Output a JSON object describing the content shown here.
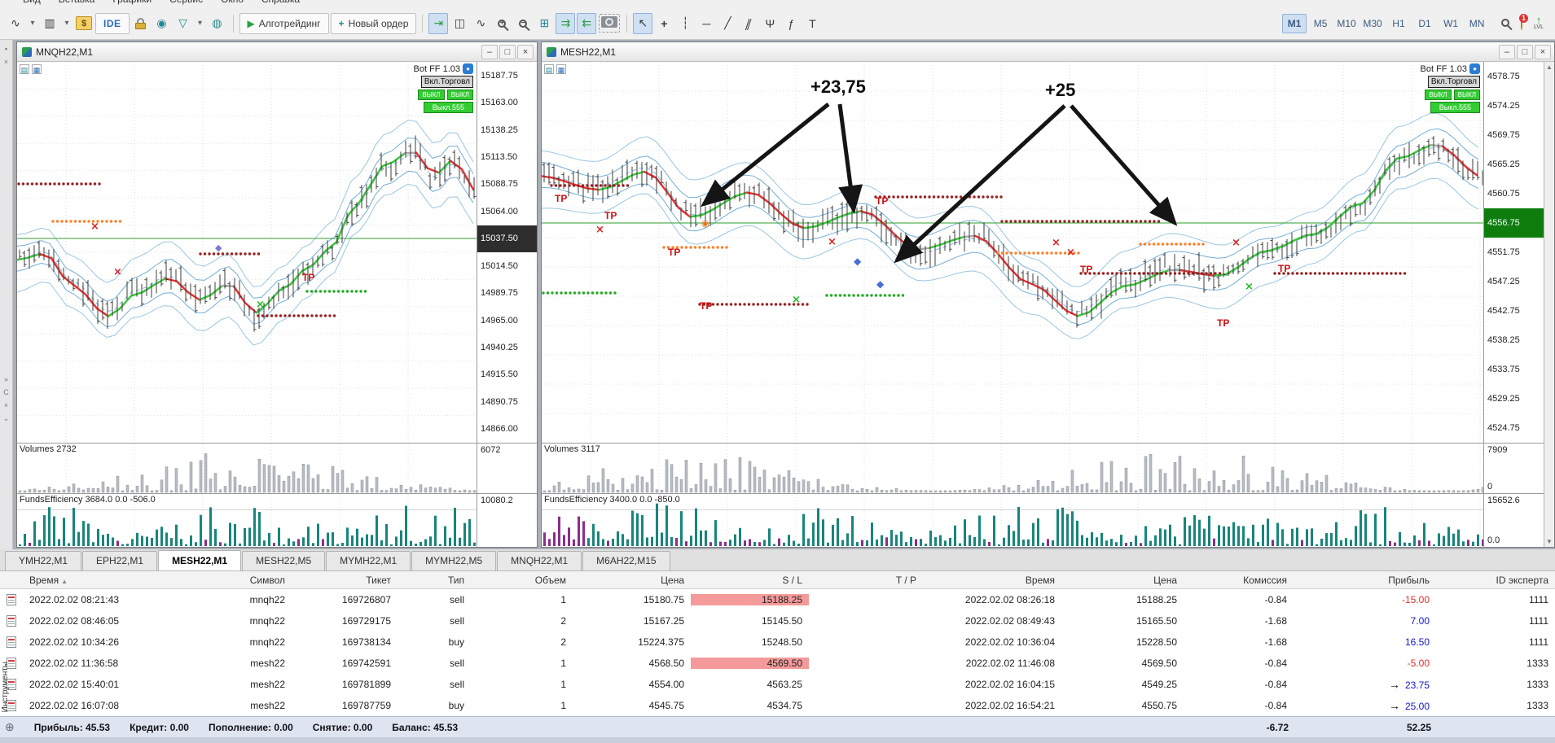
{
  "menu": {
    "items": [
      "Вид",
      "Вставка",
      "Графики",
      "Сервис",
      "Окно",
      "Справка"
    ]
  },
  "toolbar": {
    "ide": "IDE",
    "algotrading": "Алготрейдинг",
    "new_order": "Новый ордер",
    "timeframes": [
      "M1",
      "M5",
      "M10",
      "M30",
      "H1",
      "D1",
      "W1",
      "MN"
    ],
    "active_timeframe": "M1",
    "badge_count": "1",
    "lvl": "LVL"
  },
  "icons": {
    "caret_down": "▾",
    "line_style": "∿",
    "bar_style": "▥",
    "dollar": "$",
    "signal": "◉",
    "funnel": "▽",
    "copy": "◍",
    "play": "▶",
    "plus": "+",
    "autoscroll": "⇥",
    "candles": "◫",
    "line_chart": "∿",
    "grid": "⊞",
    "dock_left": "⇉",
    "dock_right": "⇇",
    "cursor": "↖",
    "crosshair": "+",
    "vline": "┆",
    "hline": "─",
    "trendline": "╱",
    "channel": "∥",
    "pitchfork": "Ψ",
    "fibo": "ƒ",
    "text_tool": "T",
    "zoom_in": "+",
    "zoom_out": "−",
    "sort_asc": "▲",
    "up_arrow": "↑",
    "minimize": "–",
    "maximize": "□",
    "close": "×",
    "row_arrow": "→",
    "plus_circle": "⊕",
    "scroll_up": "▲",
    "scroll_down": "▼",
    "strip_glyphs": [
      "▪",
      "×",
      "»",
      "C",
      "×",
      "⌄"
    ]
  },
  "charts": {
    "left": {
      "title": "MNQH22,M1",
      "bot_label": "Bot FF 1.03",
      "toggle_label": "Вкл.Торговл",
      "btn_a": "ВЫКЛ",
      "btn_b": "ВЫКЛ",
      "btn_c": "Выкл.555",
      "price_labels": [
        "15187.75",
        "15163.00",
        "15138.25",
        "15113.50",
        "15088.75",
        "15064.00",
        "15037.50",
        "15014.50",
        "14989.75",
        "14965.00",
        "14940.25",
        "14915.50",
        "14890.75",
        "14866.00"
      ],
      "current_index": 6,
      "current_price": "15037.50",
      "volumes_label": "Volumes 2732",
      "volumes_axis_top": "6072",
      "funds_label": "FundsEfficiency 3684.0 0.0 -506.0",
      "funds_axis_top": "10080.2",
      "tp_label": "TP"
    },
    "right": {
      "title": "MESH22,M1",
      "bot_label": "Bot FF 1.03",
      "toggle_label": "Вкл.Торговл",
      "btn_a": "ВЫКЛ",
      "btn_b": "ВЫКЛ",
      "btn_c": "Выкл.555",
      "price_labels": [
        "4578.75",
        "4574.25",
        "4569.75",
        "4565.25",
        "4560.75",
        "4556.75",
        "4551.75",
        "4547.25",
        "4542.75",
        "4538.25",
        "4533.75",
        "4529.25",
        "4524.75"
      ],
      "current_index": 5,
      "current_price": "4556.75",
      "volumes_label": "Volumes 3117",
      "volumes_axis_top": "7909",
      "volumes_axis_bottom": "0",
      "funds_label": "FundsEfficiency 3400.0 0.0 -850.0",
      "funds_axis_top": "15652.6",
      "funds_axis_bottom": "0.0",
      "annotation_1": "+23,75",
      "annotation_2": "+25",
      "tp_label": "TP"
    }
  },
  "chart_tabs": {
    "items": [
      "YMH22,M1",
      "EPH22,M1",
      "MESH22,M1",
      "MESH22,M5",
      "MYMH22,M1",
      "MYMH22,M5",
      "MNQH22,M1",
      "M6AH22,M15"
    ],
    "active_index": 2
  },
  "table": {
    "columns": [
      "Время",
      "Символ",
      "Тикет",
      "Тип",
      "Объем",
      "Цена",
      "S / L",
      "T / P",
      "Время",
      "Цена",
      "Комиссия",
      "Прибыль",
      "ID эксперта"
    ],
    "rows": [
      {
        "time_open": "2022.02.02 08:21:43",
        "symbol": "mnqh22",
        "ticket": "169726807",
        "type": "sell",
        "volume": "1",
        "price_open": "15180.75",
        "sl": "15188.25",
        "tp": "",
        "time_close": "2022.02.02 08:26:18",
        "price_close": "15188.25",
        "commission": "-0.84",
        "profit": "-15.00",
        "expert_id": "1111",
        "sl_hit": true,
        "arrow": false
      },
      {
        "time_open": "2022.02.02 08:46:05",
        "symbol": "mnqh22",
        "ticket": "169729175",
        "type": "sell",
        "volume": "2",
        "price_open": "15167.25",
        "sl": "15145.50",
        "tp": "",
        "time_close": "2022.02.02 08:49:43",
        "price_close": "15165.50",
        "commission": "-1.68",
        "profit": "7.00",
        "expert_id": "1111",
        "sl_hit": false,
        "arrow": false
      },
      {
        "time_open": "2022.02.02 10:34:26",
        "symbol": "mnqh22",
        "ticket": "169738134",
        "type": "buy",
        "volume": "2",
        "price_open": "15224.375",
        "sl": "15248.50",
        "tp": "",
        "time_close": "2022.02.02 10:36:04",
        "price_close": "15228.50",
        "commission": "-1.68",
        "profit": "16.50",
        "expert_id": "1111",
        "sl_hit": false,
        "arrow": false
      },
      {
        "time_open": "2022.02.02 11:36:58",
        "symbol": "mesh22",
        "ticket": "169742591",
        "type": "sell",
        "volume": "1",
        "price_open": "4568.50",
        "sl": "4569.50",
        "tp": "",
        "time_close": "2022.02.02 11:46:08",
        "price_close": "4569.50",
        "commission": "-0.84",
        "profit": "-5.00",
        "expert_id": "1333",
        "sl_hit": true,
        "arrow": false
      },
      {
        "time_open": "2022.02.02 15:40:01",
        "symbol": "mesh22",
        "ticket": "169781899",
        "type": "sell",
        "volume": "1",
        "price_open": "4554.00",
        "sl": "4563.25",
        "tp": "",
        "time_close": "2022.02.02 16:04:15",
        "price_close": "4549.25",
        "commission": "-0.84",
        "profit": "23.75",
        "expert_id": "1333",
        "sl_hit": false,
        "arrow": true
      },
      {
        "time_open": "2022.02.02 16:07:08",
        "symbol": "mesh22",
        "ticket": "169787759",
        "type": "buy",
        "volume": "1",
        "price_open": "4545.75",
        "sl": "4534.75",
        "tp": "",
        "time_close": "2022.02.02 16:54:21",
        "price_close": "4550.75",
        "commission": "-0.84",
        "profit": "25.00",
        "expert_id": "1333",
        "sl_hit": false,
        "arrow": true
      }
    ]
  },
  "status_bar": {
    "profit": "Прибыль: 45.53",
    "credit": "Кредит: 0.00",
    "deposit": "Пополнение: 0.00",
    "withdrawal": "Снятие: 0.00",
    "balance": "Баланс: 45.53",
    "commission_total": "-6.72",
    "profit_total": "52.25"
  },
  "side": {
    "toolbox_label": "Инструменты"
  }
}
